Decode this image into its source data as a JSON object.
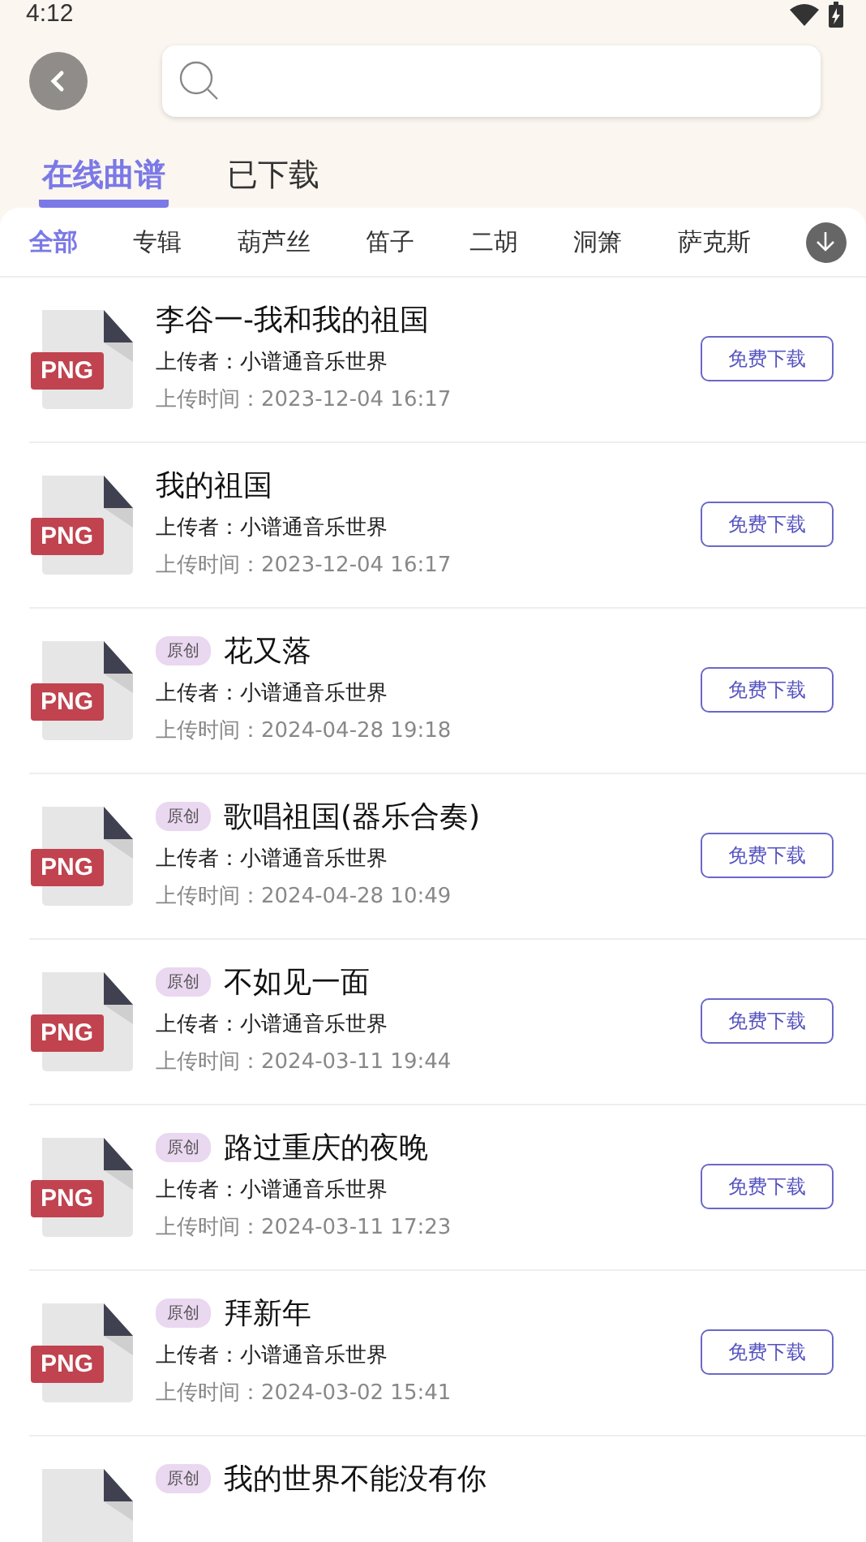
{
  "status_bar": {
    "time": "4:12"
  },
  "tabs": [
    {
      "label": "在线曲谱",
      "selected": true
    },
    {
      "label": "已下载",
      "selected": false
    }
  ],
  "categories": [
    {
      "label": "全部",
      "selected": true
    },
    {
      "label": "专辑",
      "selected": false
    },
    {
      "label": "葫芦丝",
      "selected": false
    },
    {
      "label": "笛子",
      "selected": false
    },
    {
      "label": "二胡",
      "selected": false
    },
    {
      "label": "洞箫",
      "selected": false
    },
    {
      "label": "萨克斯",
      "selected": false
    }
  ],
  "scores": [
    {
      "file_type": "PNG",
      "title": "李谷一-我和我的祖国",
      "original": false,
      "uploader": "上传者：小谱通音乐世界",
      "time": "上传时间：2023-12-04 16:17",
      "button": "免费下载"
    },
    {
      "file_type": "PNG",
      "title": "我的祖国",
      "original": false,
      "uploader": "上传者：小谱通音乐世界",
      "time": "上传时间：2023-12-04 16:17",
      "button": "免费下载"
    },
    {
      "file_type": "PNG",
      "title": "花又落",
      "original": true,
      "badge": "原创",
      "uploader": "上传者：小谱通音乐世界",
      "time": "上传时间：2024-04-28 19:18",
      "button": "免费下载"
    },
    {
      "file_type": "PNG",
      "title": "歌唱祖国(器乐合奏)",
      "original": true,
      "badge": "原创",
      "uploader": "上传者：小谱通音乐世界",
      "time": "上传时间：2024-04-28 10:49",
      "button": "免费下载"
    },
    {
      "file_type": "PNG",
      "title": "不如见一面",
      "original": true,
      "badge": "原创",
      "uploader": "上传者：小谱通音乐世界",
      "time": "上传时间：2024-03-11 19:44",
      "button": "免费下载"
    },
    {
      "file_type": "PNG",
      "title": "路过重庆的夜晚",
      "original": true,
      "badge": "原创",
      "uploader": "上传者：小谱通音乐世界",
      "time": "上传时间：2024-03-11 17:23",
      "button": "免费下载"
    },
    {
      "file_type": "PNG",
      "title": "拜新年",
      "original": true,
      "badge": "原创",
      "uploader": "上传者：小谱通音乐世界",
      "time": "上传时间：2024-03-02 15:41",
      "button": "免费下载"
    },
    {
      "title": "我的世界不能没有你",
      "original": true,
      "badge": "原创"
    }
  ]
}
